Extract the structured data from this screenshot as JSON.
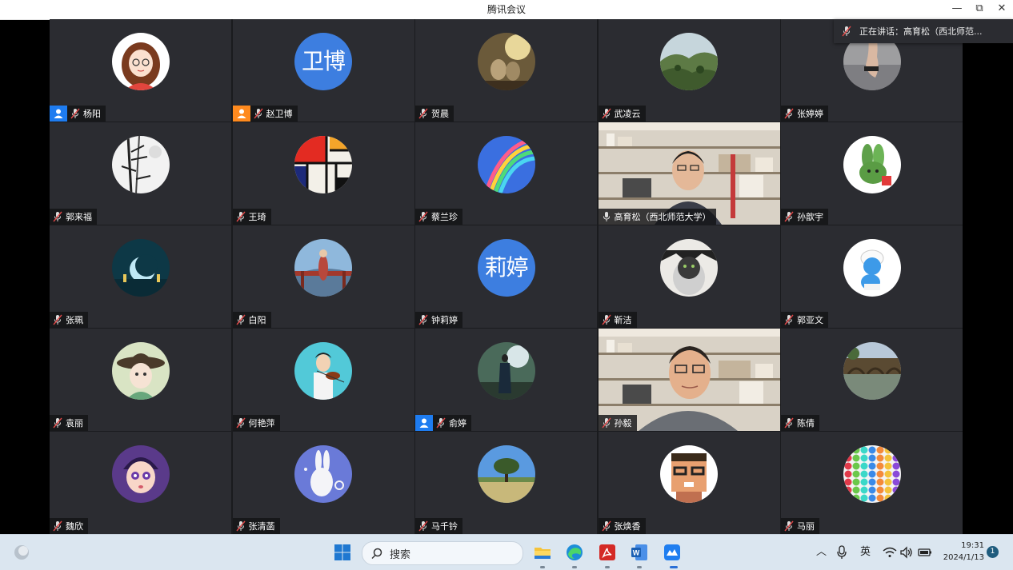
{
  "window": {
    "title": "腾讯会议",
    "minimize": "—",
    "restore": "⧉",
    "close": "✕"
  },
  "speaking": {
    "label": "正在讲话：",
    "name": "高育松（西北师范..."
  },
  "participants": [
    {
      "name": "杨阳",
      "host": "blue",
      "avatar": "girl"
    },
    {
      "name": "赵卫博",
      "host": "orange",
      "avatar": "text",
      "avatar_text": "卫博"
    },
    {
      "name": "贺晨",
      "avatar": "kittens"
    },
    {
      "name": "武凌云",
      "avatar": "hills"
    },
    {
      "name": "张婷婷",
      "avatar": "hand"
    },
    {
      "name": "郭来福",
      "avatar": "bamboo"
    },
    {
      "name": "王琦",
      "avatar": "mondrian"
    },
    {
      "name": "蔡兰珍",
      "avatar": "rainbow"
    },
    {
      "name": "高育松（西北师范大学）",
      "avatar": "video1",
      "speaking": true
    },
    {
      "name": "孙歆宇",
      "avatar": "bunny-plant"
    },
    {
      "name": "张珮",
      "avatar": "moon"
    },
    {
      "name": "白阳",
      "avatar": "pavilion"
    },
    {
      "name": "钟莉婷",
      "avatar": "text",
      "avatar_text": "莉婷"
    },
    {
      "name": "靳洁",
      "avatar": "cat"
    },
    {
      "name": "郭亚文",
      "avatar": "smurf"
    },
    {
      "name": "袁丽",
      "avatar": "hat-girl"
    },
    {
      "name": "何艳萍",
      "avatar": "violin"
    },
    {
      "name": "俞婷",
      "host": "blue",
      "avatar": "figure"
    },
    {
      "name": "孙毅",
      "avatar": "video2"
    },
    {
      "name": "陈倩",
      "avatar": "bridge"
    },
    {
      "name": "魏欣",
      "avatar": "cartoon"
    },
    {
      "name": "张清菡",
      "avatar": "rabbit"
    },
    {
      "name": "马千钤",
      "avatar": "tree"
    },
    {
      "name": "张焕香",
      "avatar": "pixel"
    },
    {
      "name": "马丽",
      "avatar": "beads"
    }
  ],
  "taskbar": {
    "search_placeholder": "搜索",
    "ime": "英",
    "time": "19:31",
    "date": "2024/1/13",
    "notifications": "1",
    "icons": [
      "weather-icon",
      "start-icon",
      "file-explorer-icon",
      "edge-icon",
      "acrobat-icon",
      "word-icon",
      "tencent-meeting-icon"
    ]
  },
  "colors": {
    "tile_bg": "#2b2c31",
    "speaking_border": "#27c26c",
    "host_blue": "#1e7cf0",
    "host_orange": "#ff8a1e",
    "text_avatar": "#3d7ee0"
  }
}
